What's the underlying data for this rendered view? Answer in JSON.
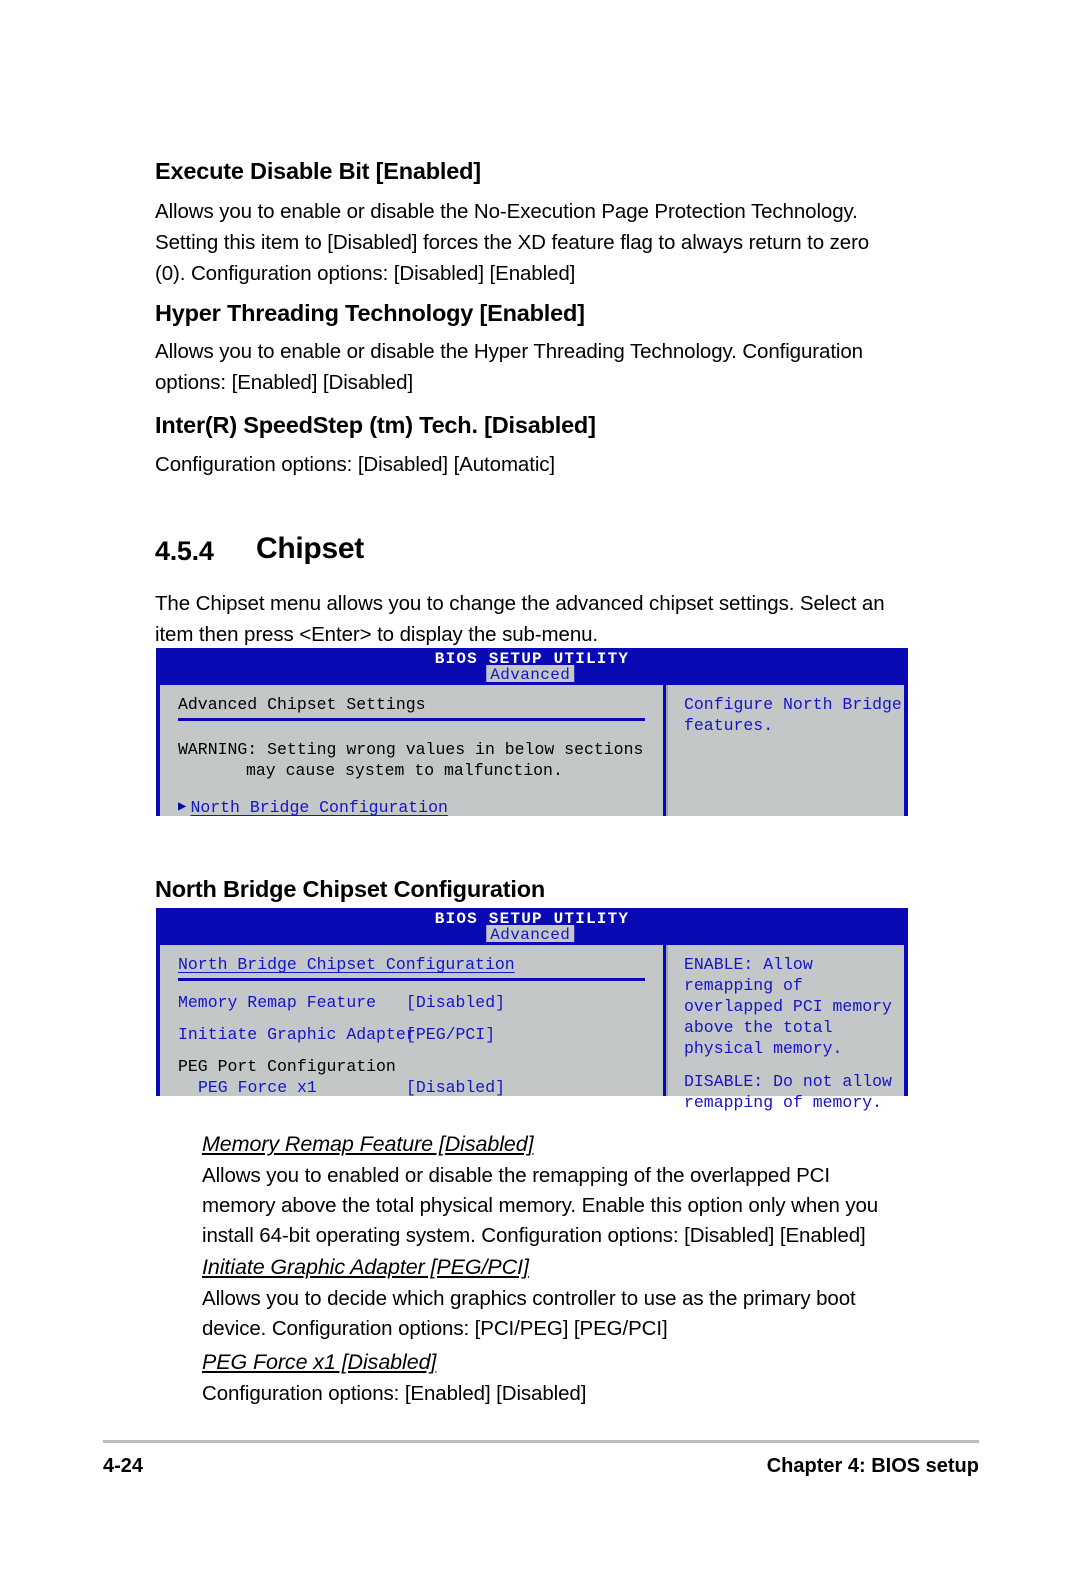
{
  "page": {
    "footer_page_number": "4-24",
    "footer_chapter": "Chapter 4: BIOS setup"
  },
  "sections": {
    "execute_disable": {
      "heading": "Execute Disable Bit [Enabled]",
      "body": "Allows you to enable or disable the No-Execution Page Protection Technology. Setting this item to [Disabled] forces the XD feature flag to always return to zero (0). Configuration options: [Disabled] [Enabled]"
    },
    "hyper_threading": {
      "heading": "Hyper Threading Technology [Enabled]",
      "body": "Allows you to enable or disable the Hyper Threading Technology. Configuration options: [Enabled] [Disabled]"
    },
    "speedstep": {
      "heading": "Inter(R) SpeedStep (tm) Tech. [Disabled]",
      "body": "Configuration options: [Disabled] [Automatic]"
    },
    "chipset": {
      "number": "4.5.4",
      "title": "Chipset",
      "body": "The Chipset menu allows you to change the advanced chipset settings. Select an item then press <Enter> to display the sub-menu."
    },
    "north_bridge": {
      "heading": "North Bridge Chipset Configuration"
    },
    "memory_remap": {
      "heading": "Memory Remap Feature [Disabled]",
      "body": "Allows you to enabled or disable the remapping of the overlapped PCI memory above the total physical memory. Enable this option only when you install 64-bit operating system. Configuration options: [Disabled] [Enabled]"
    },
    "initiate_graphic": {
      "heading": "Initiate Graphic Adapter [PEG/PCI]",
      "body": "Allows you to decide which graphics controller to use as the primary boot device. Configuration options: [PCI/PEG] [PEG/PCI]"
    },
    "peg_force": {
      "heading": "PEG Force x1 [Disabled]",
      "body": "Configuration options: [Enabled] [Disabled]"
    }
  },
  "bios_screen_1": {
    "title": "BIOS SETUP UTILITY",
    "tab": "Advanced",
    "section_header": "Advanced Chipset Settings",
    "warning_line1": "WARNING: Setting wrong values in below sections",
    "warning_line2": "may cause system to malfunction.",
    "menu_item": "North Bridge Configuration",
    "help_line1": "Configure North Bridge",
    "help_line2": "features."
  },
  "bios_screen_2": {
    "title": "BIOS SETUP UTILITY",
    "tab": "Advanced",
    "section_header": "North Bridge Chipset Configuration",
    "rows": [
      {
        "label": "Memory Remap Feature",
        "value": "[Disabled]"
      },
      {
        "label": "Initiate Graphic Adapter",
        "value": "[PEG/PCI]"
      }
    ],
    "group_label": "PEG Port Configuration",
    "sub_row": {
      "label": "PEG Force x1",
      "value": "[Disabled]"
    },
    "help_line1": "ENABLE: Allow",
    "help_line2": "remapping of",
    "help_line3": "overlapped PCI memory",
    "help_line4": "above the total",
    "help_line5": "physical memory.",
    "help_line6": "DISABLE: Do not allow",
    "help_line7": "remapping of memory."
  },
  "colors": {
    "bios_header_blue": "#0a0ab4",
    "bios_text_blue": "#1414c8",
    "bios_background": "#c3c7c8"
  }
}
